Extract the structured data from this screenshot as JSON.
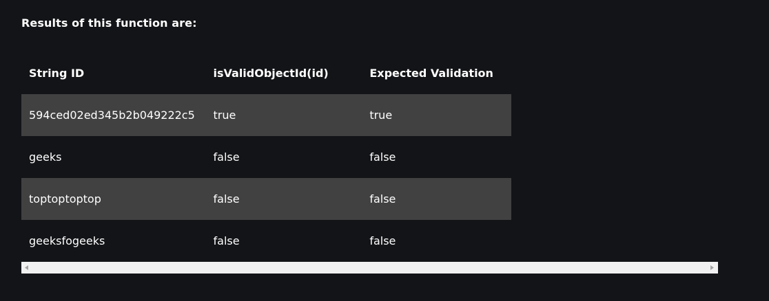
{
  "heading": "Results of this function are:",
  "table": {
    "headers": [
      "String ID",
      "isValidObjectId(id)",
      "Expected Validation"
    ],
    "rows": [
      [
        "594ced02ed345b2b049222c5",
        "true",
        "true"
      ],
      [
        "geeks",
        "false",
        "false"
      ],
      [
        "toptoptoptop",
        "false",
        "false"
      ],
      [
        "geeksfogeeks",
        "false",
        "false"
      ]
    ]
  },
  "colors": {
    "background": "#131417",
    "shaded_row": "#414141",
    "scrollbar": "#f1f1f1"
  },
  "icons": {
    "scroll_left": "scroll-left-arrow-icon",
    "scroll_right": "scroll-right-arrow-icon"
  }
}
